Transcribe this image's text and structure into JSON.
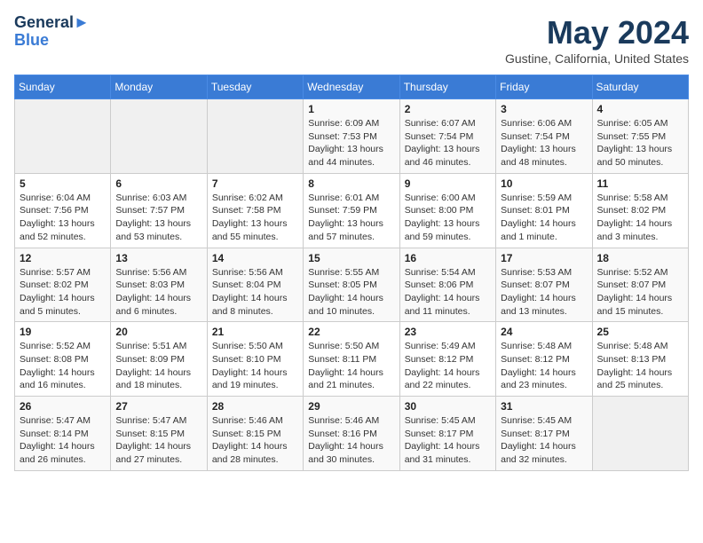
{
  "header": {
    "logo_line1": "General",
    "logo_line2": "Blue",
    "month": "May 2024",
    "location": "Gustine, California, United States"
  },
  "days_of_week": [
    "Sunday",
    "Monday",
    "Tuesday",
    "Wednesday",
    "Thursday",
    "Friday",
    "Saturday"
  ],
  "weeks": [
    [
      {
        "date": "",
        "sunrise": "",
        "sunset": "",
        "daylight": ""
      },
      {
        "date": "",
        "sunrise": "",
        "sunset": "",
        "daylight": ""
      },
      {
        "date": "",
        "sunrise": "",
        "sunset": "",
        "daylight": ""
      },
      {
        "date": "1",
        "sunrise": "Sunrise: 6:09 AM",
        "sunset": "Sunset: 7:53 PM",
        "daylight": "Daylight: 13 hours and 44 minutes."
      },
      {
        "date": "2",
        "sunrise": "Sunrise: 6:07 AM",
        "sunset": "Sunset: 7:54 PM",
        "daylight": "Daylight: 13 hours and 46 minutes."
      },
      {
        "date": "3",
        "sunrise": "Sunrise: 6:06 AM",
        "sunset": "Sunset: 7:54 PM",
        "daylight": "Daylight: 13 hours and 48 minutes."
      },
      {
        "date": "4",
        "sunrise": "Sunrise: 6:05 AM",
        "sunset": "Sunset: 7:55 PM",
        "daylight": "Daylight: 13 hours and 50 minutes."
      }
    ],
    [
      {
        "date": "5",
        "sunrise": "Sunrise: 6:04 AM",
        "sunset": "Sunset: 7:56 PM",
        "daylight": "Daylight: 13 hours and 52 minutes."
      },
      {
        "date": "6",
        "sunrise": "Sunrise: 6:03 AM",
        "sunset": "Sunset: 7:57 PM",
        "daylight": "Daylight: 13 hours and 53 minutes."
      },
      {
        "date": "7",
        "sunrise": "Sunrise: 6:02 AM",
        "sunset": "Sunset: 7:58 PM",
        "daylight": "Daylight: 13 hours and 55 minutes."
      },
      {
        "date": "8",
        "sunrise": "Sunrise: 6:01 AM",
        "sunset": "Sunset: 7:59 PM",
        "daylight": "Daylight: 13 hours and 57 minutes."
      },
      {
        "date": "9",
        "sunrise": "Sunrise: 6:00 AM",
        "sunset": "Sunset: 8:00 PM",
        "daylight": "Daylight: 13 hours and 59 minutes."
      },
      {
        "date": "10",
        "sunrise": "Sunrise: 5:59 AM",
        "sunset": "Sunset: 8:01 PM",
        "daylight": "Daylight: 14 hours and 1 minute."
      },
      {
        "date": "11",
        "sunrise": "Sunrise: 5:58 AM",
        "sunset": "Sunset: 8:02 PM",
        "daylight": "Daylight: 14 hours and 3 minutes."
      }
    ],
    [
      {
        "date": "12",
        "sunrise": "Sunrise: 5:57 AM",
        "sunset": "Sunset: 8:02 PM",
        "daylight": "Daylight: 14 hours and 5 minutes."
      },
      {
        "date": "13",
        "sunrise": "Sunrise: 5:56 AM",
        "sunset": "Sunset: 8:03 PM",
        "daylight": "Daylight: 14 hours and 6 minutes."
      },
      {
        "date": "14",
        "sunrise": "Sunrise: 5:56 AM",
        "sunset": "Sunset: 8:04 PM",
        "daylight": "Daylight: 14 hours and 8 minutes."
      },
      {
        "date": "15",
        "sunrise": "Sunrise: 5:55 AM",
        "sunset": "Sunset: 8:05 PM",
        "daylight": "Daylight: 14 hours and 10 minutes."
      },
      {
        "date": "16",
        "sunrise": "Sunrise: 5:54 AM",
        "sunset": "Sunset: 8:06 PM",
        "daylight": "Daylight: 14 hours and 11 minutes."
      },
      {
        "date": "17",
        "sunrise": "Sunrise: 5:53 AM",
        "sunset": "Sunset: 8:07 PM",
        "daylight": "Daylight: 14 hours and 13 minutes."
      },
      {
        "date": "18",
        "sunrise": "Sunrise: 5:52 AM",
        "sunset": "Sunset: 8:07 PM",
        "daylight": "Daylight: 14 hours and 15 minutes."
      }
    ],
    [
      {
        "date": "19",
        "sunrise": "Sunrise: 5:52 AM",
        "sunset": "Sunset: 8:08 PM",
        "daylight": "Daylight: 14 hours and 16 minutes."
      },
      {
        "date": "20",
        "sunrise": "Sunrise: 5:51 AM",
        "sunset": "Sunset: 8:09 PM",
        "daylight": "Daylight: 14 hours and 18 minutes."
      },
      {
        "date": "21",
        "sunrise": "Sunrise: 5:50 AM",
        "sunset": "Sunset: 8:10 PM",
        "daylight": "Daylight: 14 hours and 19 minutes."
      },
      {
        "date": "22",
        "sunrise": "Sunrise: 5:50 AM",
        "sunset": "Sunset: 8:11 PM",
        "daylight": "Daylight: 14 hours and 21 minutes."
      },
      {
        "date": "23",
        "sunrise": "Sunrise: 5:49 AM",
        "sunset": "Sunset: 8:12 PM",
        "daylight": "Daylight: 14 hours and 22 minutes."
      },
      {
        "date": "24",
        "sunrise": "Sunrise: 5:48 AM",
        "sunset": "Sunset: 8:12 PM",
        "daylight": "Daylight: 14 hours and 23 minutes."
      },
      {
        "date": "25",
        "sunrise": "Sunrise: 5:48 AM",
        "sunset": "Sunset: 8:13 PM",
        "daylight": "Daylight: 14 hours and 25 minutes."
      }
    ],
    [
      {
        "date": "26",
        "sunrise": "Sunrise: 5:47 AM",
        "sunset": "Sunset: 8:14 PM",
        "daylight": "Daylight: 14 hours and 26 minutes."
      },
      {
        "date": "27",
        "sunrise": "Sunrise: 5:47 AM",
        "sunset": "Sunset: 8:15 PM",
        "daylight": "Daylight: 14 hours and 27 minutes."
      },
      {
        "date": "28",
        "sunrise": "Sunrise: 5:46 AM",
        "sunset": "Sunset: 8:15 PM",
        "daylight": "Daylight: 14 hours and 28 minutes."
      },
      {
        "date": "29",
        "sunrise": "Sunrise: 5:46 AM",
        "sunset": "Sunset: 8:16 PM",
        "daylight": "Daylight: 14 hours and 30 minutes."
      },
      {
        "date": "30",
        "sunrise": "Sunrise: 5:45 AM",
        "sunset": "Sunset: 8:17 PM",
        "daylight": "Daylight: 14 hours and 31 minutes."
      },
      {
        "date": "31",
        "sunrise": "Sunrise: 5:45 AM",
        "sunset": "Sunset: 8:17 PM",
        "daylight": "Daylight: 14 hours and 32 minutes."
      },
      {
        "date": "",
        "sunrise": "",
        "sunset": "",
        "daylight": ""
      }
    ]
  ]
}
